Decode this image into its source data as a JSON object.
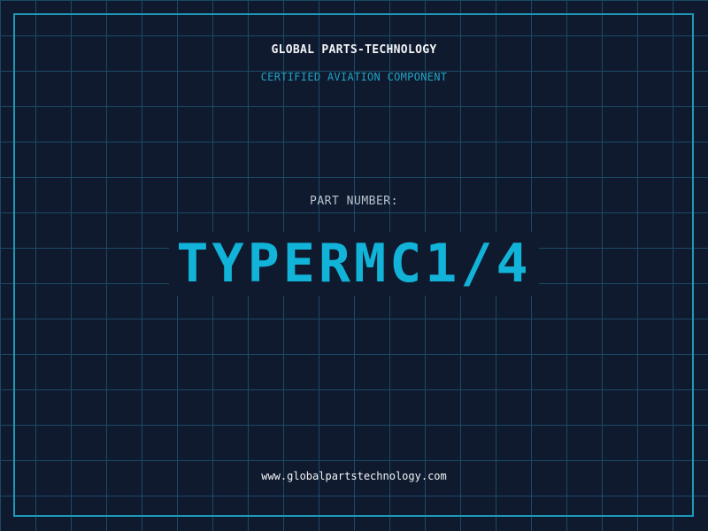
{
  "header": {
    "company": "GLOBAL PARTS-TECHNOLOGY",
    "subtitle": "CERTIFIED AVIATION COMPONENT"
  },
  "part": {
    "label": "PART NUMBER:",
    "number": "TYPERMC1/4"
  },
  "footer": {
    "website": "www.globalpartstechnology.com"
  },
  "colors": {
    "background": "#101a2f",
    "grid": "#1b4a64",
    "accent": "#12b3d8",
    "text": "#f2f4f7"
  }
}
